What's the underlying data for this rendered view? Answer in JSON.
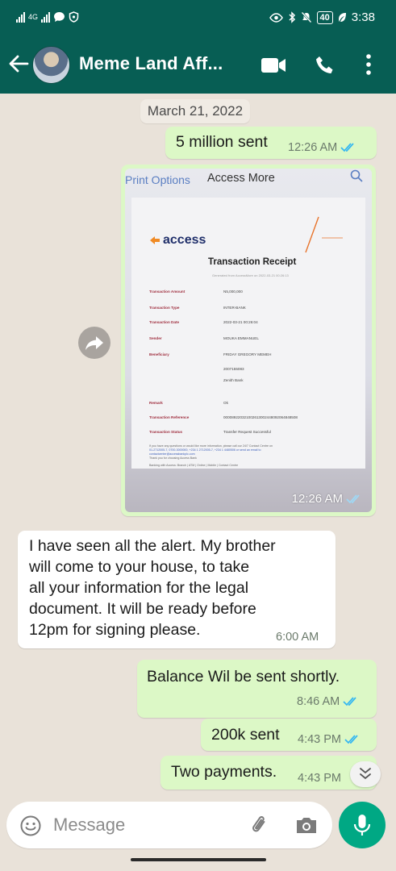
{
  "status_bar": {
    "network": "4G",
    "battery": "40",
    "time": "3:38"
  },
  "header": {
    "title": "Meme Land Aff...",
    "icons": [
      "back-arrow-icon",
      "video-call-icon",
      "phone-call-icon",
      "more-vert-icon"
    ]
  },
  "chat": {
    "date_chip": "March 21, 2022",
    "messages": [
      {
        "direction": "out",
        "text": "5 million sent",
        "time": "12:26 AM",
        "read": true
      },
      {
        "direction": "out",
        "type": "image",
        "time": "12:26 AM",
        "read": true,
        "photo": {
          "print_options": "Print Options",
          "access_more": "Access More",
          "logo": "access",
          "receipt_title": "Transaction Receipt",
          "generated_line": "Generated from AccessMore on 2022-03-21 00:26:13",
          "rows": [
            {
              "label": "Transaction Amount",
              "value": "N5,000,000"
            },
            {
              "label": "Transaction Type",
              "value": "INTER-BANK"
            },
            {
              "label": "Transaction Date",
              "value": "2022-03-21 00:26:04"
            },
            {
              "label": "Sender",
              "value": "MOUKA EMMANUEL"
            },
            {
              "label": "Beneficiary",
              "value": "FRIDAY GREGORY MEMEH"
            },
            {
              "label": "",
              "value": "2007155083"
            },
            {
              "label": "",
              "value": "Zenith Bank"
            },
            {
              "label": "Remark",
              "value": "Ok"
            },
            {
              "label": "Transaction Reference",
              "value": "000089220321002613002448092064848508"
            },
            {
              "label": "Transaction Status",
              "value": "Transfer Request Successful"
            }
          ],
          "footer_line_1": "If you have any questions or would like more information, please call our 24/7 Contact Centre on",
          "footer_line_2": "01-2712005-7, 0700-3000000, +234 1 2712005-7, +234 1 4480506 or send an email to",
          "footer_line_3": "contactcenter@accessbankplc.com",
          "footer_line_4": "Thank you for choosing Access Bank",
          "footer_line_5": "Banking with Access: Branch | ATM | Online | Mobile | Contact Centre"
        }
      },
      {
        "direction": "in",
        "lines": [
          "I have seen all the alert. My brother",
          "will come to your house, to take",
          "all your information for the legal",
          "document. It will be ready before",
          "12pm for signing please."
        ],
        "time": "6:00 AM"
      },
      {
        "direction": "out",
        "text": "Balance Wil be sent shortly.",
        "time": "8:46 AM",
        "read": true
      },
      {
        "direction": "out",
        "text": "200k sent",
        "time": "4:43 PM",
        "read": true
      },
      {
        "direction": "out",
        "text": "Two payments.",
        "time": "4:43 PM",
        "read": true
      }
    ]
  },
  "input": {
    "placeholder": "Message",
    "icons": [
      "emoji-icon",
      "attach-icon",
      "camera-icon",
      "mic-icon"
    ]
  },
  "colors": {
    "header": "#075e54",
    "outgoing_bubble": "#dcf8c6",
    "incoming_bubble": "#ffffff",
    "chat_background": "#e9e2d9",
    "read_ticks": "#34b7f1",
    "mic_button": "#00a884"
  }
}
